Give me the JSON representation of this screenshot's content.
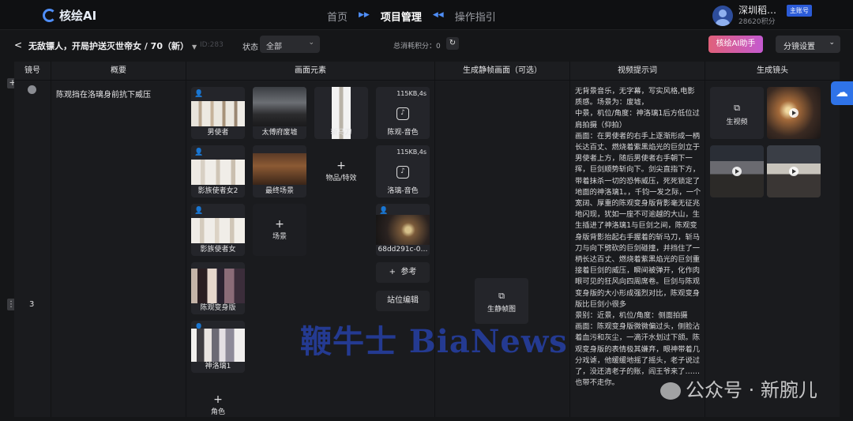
{
  "app": {
    "name": "核绘AI"
  },
  "nav": {
    "items": [
      "首页",
      "项目管理",
      "操作指引"
    ],
    "active": "项目管理"
  },
  "user": {
    "name": "深圳稻…",
    "credits": "28620积分",
    "badge": "主账号"
  },
  "project": {
    "back": "<",
    "title": "无敌镖人，开局护送灭世帝女 / 70（新）",
    "id": "ID:283"
  },
  "filter": {
    "state_label": "状态",
    "state_value": "全部"
  },
  "total_points": "总消耗积分：0",
  "buttons": {
    "ai_assistant": "核绘AI助手",
    "split_settings": "分镜设置"
  },
  "table": {
    "headers": [
      "镜号",
      "概要",
      "画面元素",
      "生成静帧画面（可选）",
      "视频提示词",
      "生成镜头"
    ],
    "row_number": "3",
    "summary": "陈观挡在洛璃身前抗下威压",
    "elements": [
      {
        "label": "男使者",
        "type": "character"
      },
      {
        "label": "影族使者女2",
        "type": "character"
      },
      {
        "label": "影族使者女",
        "type": "character"
      },
      {
        "label": "陈观变身版",
        "type": "character"
      },
      {
        "label": "神洛璃1",
        "type": "character"
      },
      {
        "label": "太傅府废墟",
        "type": "scene"
      },
      {
        "label": "最终场景",
        "type": "scene"
      },
      {
        "label": "斩马刀",
        "type": "prop"
      },
      {
        "label": "陈观-音色",
        "size": "115KB,4s"
      },
      {
        "label": "洛璃-音色",
        "size": "115KB,4s"
      },
      {
        "label": "68dd291c-0…",
        "type": "image"
      }
    ],
    "add_role": "角色",
    "add_scene": "场景",
    "add_prop": "物品/特效",
    "reference": "参考",
    "position_edit": "站位编辑",
    "still_frame_btn": "生静帧图",
    "video_prompt": "无背景音乐，无字幕，写实风格,电影质感。场景为：废墟，\n中景，机位/角度：神洛璃1后方低位过肩拍摄（仰拍）\n画面：在男使者的右手上逐渐形成一柄长达百丈、燃烧着紫黑焰光的巨剑立于男使者上方，随后男使者右手朝下一挥，巨剑顺势斩向下。剑尖直指下方，带着抹杀一切的恐怖威压，死死锁定了地面的神洛璃1。，千钧一发之际，一个宽阔、厚重的陈观变身版背影毫无征兆地闪现，犹如一座不可逾越的大山，生生插进了神洛璃1与巨剑之间，陈观变身版背影抬起右手握着的斩马刀，斩马刀与向下劈砍的巨剑碰撞，并挡住了一柄长达百丈、燃烧着紫黑焰光的巨剑重接着巨剑的威压，瞬间被弹开，化作肉眼可见的狂风向四周席卷。巨剑与陈观变身版的大小形成强烈对比，陈观变身版比巨剑小很多\n景别：近景，机位/角度：侧面拍摄\n画面：陈观变身版微微偏过头，侧脸沾着血污和灰尘，一滴汗水划过下颌。陈观变身版的表情极其嫌弃，眼神带着几分戏谑，他缓缓地摇了摇头，老子说过了，没还清老子的账，阎王爷来了……也带不走你。",
    "gen_video_btn": "生视频"
  },
  "watermarks": {
    "left": "鞭牛士 BiaNews",
    "right": "公众号 · 新腕儿"
  }
}
